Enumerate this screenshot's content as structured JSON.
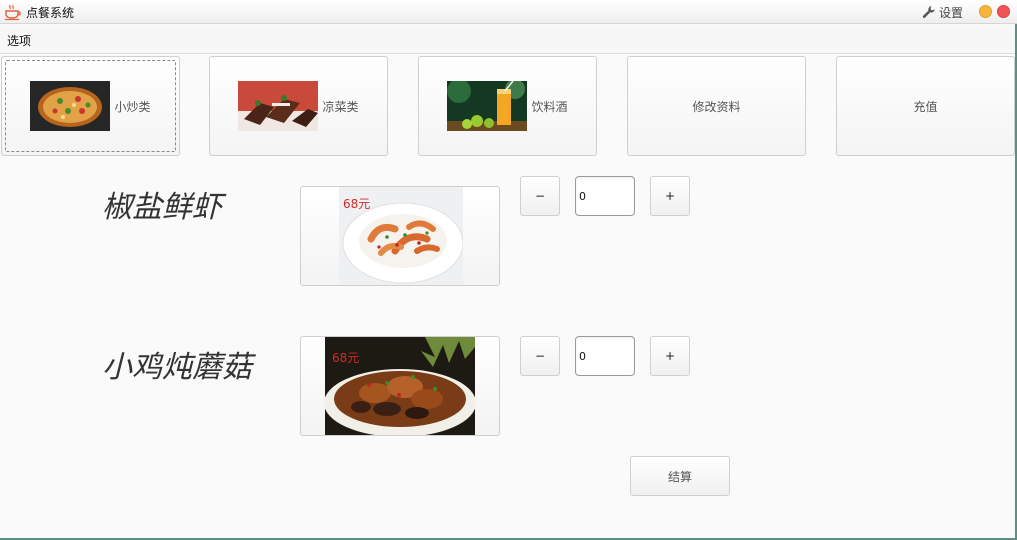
{
  "window": {
    "title": "点餐系统",
    "settings_label": "设置"
  },
  "menu": {
    "options_label": "选项"
  },
  "categories": [
    {
      "label": "小炒类",
      "icon": "pizza-thumbnail"
    },
    {
      "label": "凉菜类",
      "icon": "cake-thumbnail"
    },
    {
      "label": "饮料酒",
      "icon": "drink-thumbnail"
    },
    {
      "label": "修改资料"
    },
    {
      "label": "充值"
    }
  ],
  "dishes": [
    {
      "name": "椒盐鲜虾",
      "price": "68元",
      "quantity": "0",
      "minus": "−",
      "plus": "+"
    },
    {
      "name": "小鸡炖蘑菇",
      "price": "68元",
      "quantity": "0",
      "minus": "−",
      "plus": "+"
    }
  ],
  "checkout_label": "结算",
  "colors": {
    "price": "#d12a2a",
    "minimize": "#f6b53a",
    "close": "#f25454",
    "frame_accent": "#5a8f86"
  }
}
